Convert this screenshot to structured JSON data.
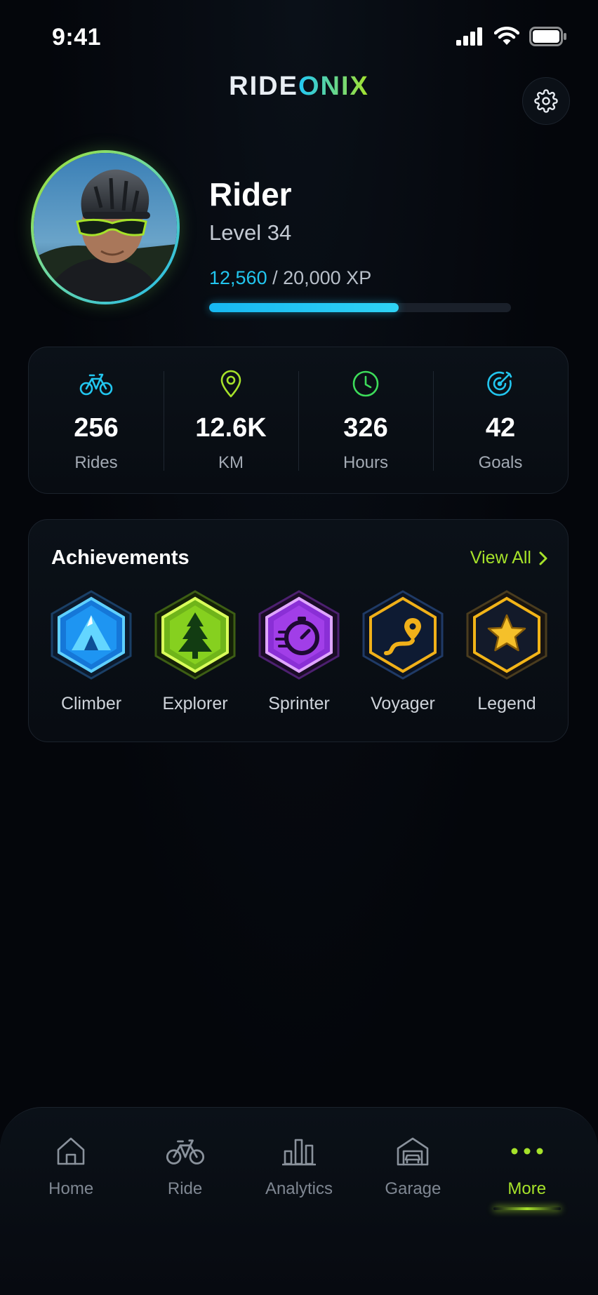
{
  "status": {
    "time": "9:41"
  },
  "header": {
    "brand_part1": "RIDE",
    "brand_part2": "ONIX",
    "settings_icon": "gear-icon"
  },
  "profile": {
    "name": "Rider",
    "level": "Level 34",
    "xp_current": "12,560",
    "xp_total": " / 20,000 XP",
    "xp_progress": 0.628
  },
  "stats": [
    {
      "icon": "bike-icon",
      "value": "256",
      "label": "Rides",
      "color": "#22c6ef"
    },
    {
      "icon": "map-pin-icon",
      "value": "12.6K",
      "label": "KM",
      "color": "#a6e22a"
    },
    {
      "icon": "clock-icon",
      "value": "326",
      "label": "Hours",
      "color": "#3ddc5a"
    },
    {
      "icon": "target-icon",
      "value": "42",
      "label": "Goals",
      "color": "#22c6ef"
    }
  ],
  "achievements": {
    "title": "Achievements",
    "view_all": "View All",
    "badges": [
      {
        "icon": "mountain-icon",
        "label": "Climber",
        "color": "#1e9bf0"
      },
      {
        "icon": "tree-icon",
        "label": "Explorer",
        "color": "#8ed420"
      },
      {
        "icon": "stopwatch-icon",
        "label": "Sprinter",
        "color": "#a23ee8"
      },
      {
        "icon": "route-icon",
        "label": "Voyager",
        "color": "#f0b019"
      },
      {
        "icon": "star-icon",
        "label": "Legend",
        "color": "#f2b418"
      }
    ]
  },
  "nav": {
    "items": [
      {
        "icon": "home-icon",
        "label": "Home"
      },
      {
        "icon": "bike-icon",
        "label": "Ride"
      },
      {
        "icon": "bar-chart-icon",
        "label": "Analytics"
      },
      {
        "icon": "garage-icon",
        "label": "Garage"
      },
      {
        "icon": "more-dots-icon",
        "label": "More"
      }
    ],
    "active": "More"
  }
}
